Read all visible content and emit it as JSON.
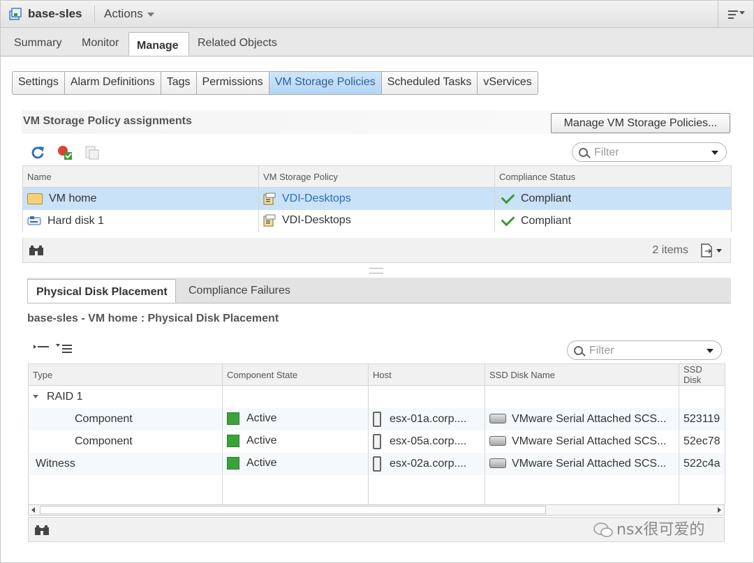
{
  "header": {
    "vm_name": "base-sles",
    "actions_label": "Actions"
  },
  "main_tabs": [
    "Summary",
    "Monitor",
    "Manage",
    "Related Objects"
  ],
  "sub_tabs": [
    "Settings",
    "Alarm Definitions",
    "Tags",
    "Permissions",
    "VM Storage Policies",
    "Scheduled Tasks",
    "vServices"
  ],
  "assignments": {
    "title": "VM Storage Policy assignments",
    "manage_button": "Manage VM Storage Policies...",
    "filter_placeholder": "Filter",
    "columns": [
      "Name",
      "VM Storage Policy",
      "Compliance Status"
    ],
    "rows": [
      {
        "name": "VM home",
        "icon": "folder-icon",
        "policy": "VDI-Desktops",
        "status": "Compliant"
      },
      {
        "name": "Hard disk 1",
        "icon": "hard-disk-icon",
        "policy": "VDI-Desktops",
        "status": "Compliant"
      }
    ],
    "item_count": "2 items"
  },
  "bottom_tabs": [
    "Physical Disk Placement",
    "Compliance Failures"
  ],
  "placement": {
    "title": "base-sles - VM home : Physical Disk Placement",
    "filter_placeholder": "Filter",
    "columns": [
      "Type",
      "Component State",
      "Host",
      "SSD Disk Name",
      "SSD Disk"
    ],
    "rows": [
      {
        "type": "RAID 1",
        "state": "",
        "host": "",
        "ssd_name": "",
        "ssd_uuid": ""
      },
      {
        "type": "Component",
        "state": "Active",
        "host": "esx-01a.corp....",
        "ssd_name": "VMware Serial Attached SCS...",
        "ssd_uuid": "523119"
      },
      {
        "type": "Component",
        "state": "Active",
        "host": "esx-05a.corp....",
        "ssd_name": "VMware Serial Attached SCS...",
        "ssd_uuid": "52ec78"
      },
      {
        "type": "Witness",
        "state": "Active",
        "host": "esx-02a.corp....",
        "ssd_name": "VMware Serial Attached SCS...",
        "ssd_uuid": "522c4a"
      }
    ]
  },
  "watermark": "nsx很可爱的",
  "colors": {
    "selected_row": "#c9e2f8",
    "active_subtab": "#b4d6f4",
    "link": "#2a6cc0",
    "active_state": "#3ca23a",
    "check": "#3a9a32"
  }
}
